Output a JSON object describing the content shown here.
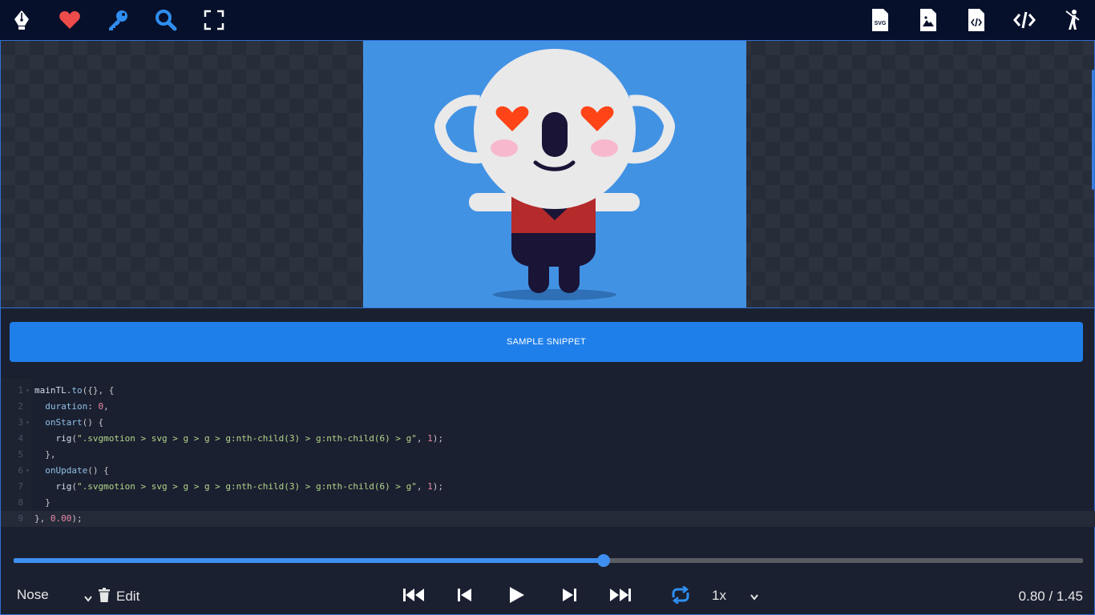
{
  "toolbar_left": [
    {
      "icon": "pen-nib-icon"
    },
    {
      "icon": "heart-icon"
    },
    {
      "icon": "key-icon"
    },
    {
      "icon": "search-icon"
    },
    {
      "icon": "fullscreen-icon"
    }
  ],
  "toolbar_right": [
    {
      "icon": "svg-file-icon",
      "label": "SVG"
    },
    {
      "icon": "image-file-icon"
    },
    {
      "icon": "code-file-icon"
    },
    {
      "icon": "code-icon"
    },
    {
      "icon": "golfer-icon"
    }
  ],
  "colors": {
    "topbar": "#07102b",
    "accent": "#1f7fea",
    "artboard": "#4292e4",
    "heart": "#ee4b4b",
    "icon_blue": "#2f8ef0"
  },
  "snippet_button": {
    "label": "SAMPLE SNIPPET"
  },
  "code": {
    "lines": [
      {
        "n": "1",
        "fold": "▾",
        "tokens": [
          [
            "fn",
            "mainTL"
          ],
          [
            "pun",
            "."
          ],
          [
            "key",
            "to"
          ],
          [
            "pun",
            "({}, {"
          ]
        ]
      },
      {
        "n": "2",
        "fold": "",
        "tokens": [
          [
            "pun",
            "  "
          ],
          [
            "key",
            "duration"
          ],
          [
            "pun",
            ": "
          ],
          [
            "num",
            "0"
          ],
          [
            "pun",
            ","
          ]
        ]
      },
      {
        "n": "3",
        "fold": "▾",
        "tokens": [
          [
            "pun",
            "  "
          ],
          [
            "key",
            "onStart"
          ],
          [
            "pun",
            "() {"
          ]
        ]
      },
      {
        "n": "4",
        "fold": "",
        "tokens": [
          [
            "pun",
            "    "
          ],
          [
            "fn",
            "rig"
          ],
          [
            "pun",
            "("
          ],
          [
            "str",
            "\".svgmotion > svg > g > g > g:nth-child(3) > g:nth-child(6) > g\""
          ],
          [
            "pun",
            ", "
          ],
          [
            "num",
            "1"
          ],
          [
            "pun",
            ");"
          ]
        ]
      },
      {
        "n": "5",
        "fold": "",
        "tokens": [
          [
            "pun",
            "  },"
          ]
        ]
      },
      {
        "n": "6",
        "fold": "▾",
        "tokens": [
          [
            "pun",
            "  "
          ],
          [
            "key",
            "onUpdate"
          ],
          [
            "pun",
            "() {"
          ]
        ]
      },
      {
        "n": "7",
        "fold": "",
        "tokens": [
          [
            "pun",
            "    "
          ],
          [
            "fn",
            "rig"
          ],
          [
            "pun",
            "("
          ],
          [
            "str",
            "\".svgmotion > svg > g > g > g:nth-child(3) > g:nth-child(6) > g\""
          ],
          [
            "pun",
            ", "
          ],
          [
            "num",
            "1"
          ],
          [
            "pun",
            ");"
          ]
        ]
      },
      {
        "n": "8",
        "fold": "",
        "tokens": [
          [
            "pun",
            "  }"
          ]
        ]
      },
      {
        "n": "9",
        "fold": "",
        "tokens": [
          [
            "pun",
            "}, "
          ],
          [
            "num",
            "0.00"
          ],
          [
            "pun",
            ");"
          ]
        ]
      }
    ],
    "active_line": 9
  },
  "timeline": {
    "progress": 0.552
  },
  "layer_select": {
    "value": "Nose"
  },
  "edit_button": {
    "label": "Edit"
  },
  "playback": {
    "speed": "1x",
    "loop": true
  },
  "time_display": "0.80 / 1.45"
}
